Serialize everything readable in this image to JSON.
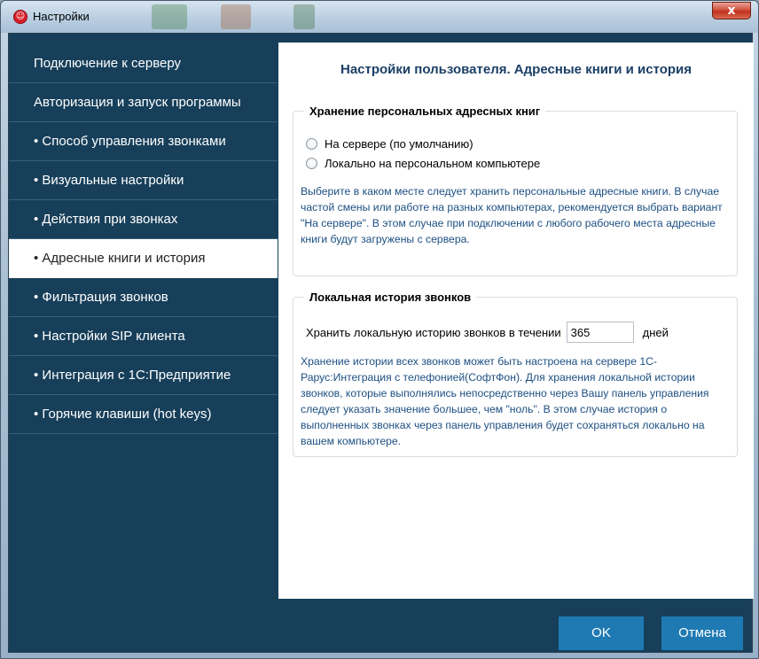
{
  "window": {
    "title": "Настройки",
    "close_label": "x"
  },
  "sidebar": {
    "items": [
      {
        "label": "Подключение к серверу",
        "active": false
      },
      {
        "label": "Авторизация и запуск программы",
        "active": false
      },
      {
        "label": "• Способ управления звонками",
        "active": false
      },
      {
        "label": "• Визуальные настройки",
        "active": false
      },
      {
        "label": "• Действия при звонках",
        "active": false
      },
      {
        "label": "• Адресные книги и история",
        "active": true
      },
      {
        "label": "• Фильтрация звонков",
        "active": false
      },
      {
        "label": "• Настройки SIP клиента",
        "active": false
      },
      {
        "label": "• Интеграция с 1С:Предприятие",
        "active": false
      },
      {
        "label": "• Горячие клавиши (hot keys)",
        "active": false
      }
    ]
  },
  "content": {
    "title": "Настройки пользователя. Адресные книги и история",
    "storage": {
      "legend": "Хранение персональных адресных книг",
      "options": [
        "На сервере (по умолчанию)",
        "Локально на персональном компьютере"
      ],
      "help": "Выберите в каком месте следует хранить персональные адресные книги. В случае частой смены или работе на разных компьютерах, рекомендуется выбрать вариант \"На сервере\". В этом случае при подключении с любого рабочего места адресные книги будут загружены с сервера."
    },
    "history": {
      "legend": "Локальная история звонков",
      "label": "Хранить локальную историю звонков в течении",
      "value": "365",
      "unit": "дней",
      "help": "Хранение истории всех звонков может быть настроена на сервере 1С-Рарус:Интеграция с телефонией(СофтФон). Для хранения локальной истории звонков, которые выполнялись непосредственно через Вашу панель управления следует указать значение большее, чем \"ноль\". В этом случае история о выполненных звонках через панель управления будет сохраняться локально на вашем компьютере."
    }
  },
  "buttons": {
    "ok": "OK",
    "cancel": "Отмена"
  },
  "colors": {
    "sidebar_bg": "#173f5a",
    "accent": "#1f7ab3",
    "title_text": "#1b3f66",
    "help_text": "#1d4f82"
  }
}
